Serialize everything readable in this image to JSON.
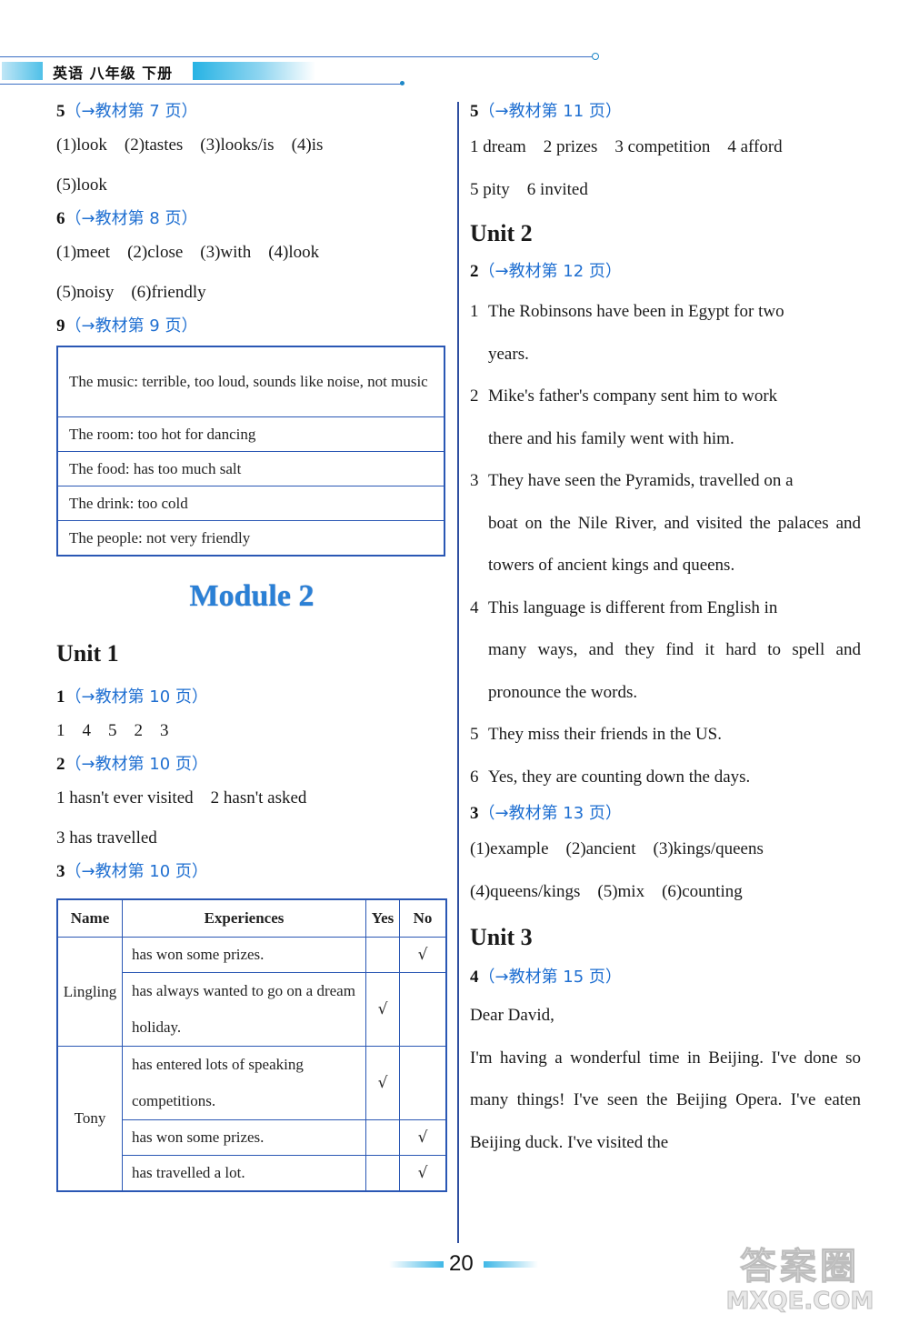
{
  "header": {
    "book_title": "英语 八年级 下册"
  },
  "left_column": {
    "q5": {
      "num": "5",
      "ref": "（→教材第 7 页）",
      "lines": [
        "(1)look　(2)tastes　(3)looks/is　(4)is",
        "(5)look"
      ]
    },
    "q6": {
      "num": "6",
      "ref": "（→教材第 8 页）",
      "lines": [
        "(1)meet　(2)close　(3)with　(4)look",
        "(5)noisy　(6)friendly"
      ]
    },
    "q9": {
      "num": "9",
      "ref": "（→教材第 9 页）",
      "table_rows": [
        "The music: terrible, too loud, sounds like noise, not music",
        "The room: too hot for dancing",
        "The food: has too much salt",
        "The drink: too cold",
        "The people: not very friendly"
      ]
    },
    "module_title": "Module 2",
    "unit1_title": "Unit 1",
    "u1q1": {
      "num": "1",
      "ref": "（→教材第 10 页）",
      "lines": [
        "1　4　5　2　3"
      ]
    },
    "u1q2": {
      "num": "2",
      "ref": "（→教材第 10 页）",
      "lines": [
        "1 hasn't ever visited　2 hasn't asked",
        "3 has travelled"
      ]
    },
    "u1q3": {
      "num": "3",
      "ref": "（→教材第 10 页）",
      "table_headers": [
        "Name",
        "Experiences",
        "Yes",
        "No"
      ],
      "groups": [
        {
          "name": "Lingling",
          "rows": [
            {
              "experience": "has won some prizes.",
              "yes": "",
              "no": "√"
            },
            {
              "experience": "has always wanted to go on a dream holiday.",
              "yes": "√",
              "no": ""
            }
          ]
        },
        {
          "name": "Tony",
          "rows": [
            {
              "experience": "has entered lots of speaking competitions.",
              "yes": "√",
              "no": ""
            },
            {
              "experience": "has won some prizes.",
              "yes": "",
              "no": "√"
            },
            {
              "experience": "has travelled a lot.",
              "yes": "",
              "no": "√"
            }
          ]
        }
      ]
    }
  },
  "right_column": {
    "u1q5": {
      "num": "5",
      "ref": "（→教材第 11 页）",
      "lines": [
        "1 dream　2 prizes　3 competition　4 afford",
        "5 pity　6 invited"
      ]
    },
    "unit2_title": "Unit 2",
    "u2q2": {
      "num": "2",
      "ref": "（→教材第 12 页）",
      "answers": [
        {
          "n": "1",
          "first": "The Robinsons have been in Egypt for two",
          "rest": "years."
        },
        {
          "n": "2",
          "first": "Mike's father's company sent him to work",
          "rest": "there and his family went with him."
        },
        {
          "n": "3",
          "first": "They have seen the Pyramids, travelled on a",
          "rest": "boat on the Nile River, and visited the palaces and towers of ancient kings and queens."
        },
        {
          "n": "4",
          "first": "This language is different from English in",
          "rest": "many ways, and they find it hard to spell and pronounce the words."
        },
        {
          "n": "5",
          "first": "They miss their friends in the US.",
          "rest": ""
        },
        {
          "n": "6",
          "first": "Yes, they are counting down the days.",
          "rest": ""
        }
      ]
    },
    "u2q3": {
      "num": "3",
      "ref": "（→教材第 13 页）",
      "lines": [
        "(1)example　(2)ancient　(3)kings/queens",
        "(4)queens/kings　(5)mix　(6)counting"
      ]
    },
    "unit3_title": "Unit 3",
    "u3q4": {
      "num": "4",
      "ref": "（→教材第 15 页）",
      "greeting": "Dear David,",
      "body": "I'm having a wonderful time in Beijing. I've done so many things! I've seen the Beijing Opera. I've eaten Beijing duck. I've visited the"
    }
  },
  "footer": {
    "page_number": "20"
  },
  "watermark": {
    "line1": "答案圈",
    "line2": "MXQE.COM"
  }
}
